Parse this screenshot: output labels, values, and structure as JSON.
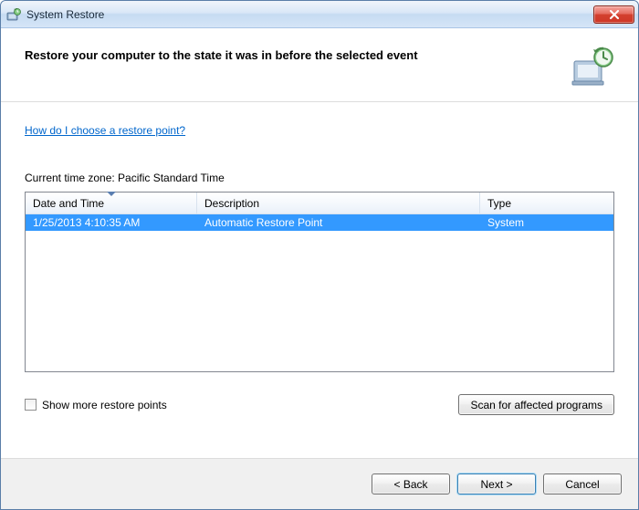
{
  "window": {
    "title": "System Restore"
  },
  "header": {
    "title": "Restore your computer to the state it was in before the selected event"
  },
  "help_link": "How do I choose a restore point?",
  "timezone_label": "Current time zone: Pacific Standard Time",
  "table": {
    "columns": {
      "date_time": "Date and Time",
      "description": "Description",
      "type": "Type"
    },
    "rows": [
      {
        "date_time": "1/25/2013 4:10:35 AM",
        "description": "Automatic Restore Point",
        "type": "System",
        "selected": true
      }
    ]
  },
  "checkbox": {
    "show_more": "Show more restore points"
  },
  "buttons": {
    "scan": "Scan for affected programs",
    "back": "< Back",
    "next": "Next >",
    "cancel": "Cancel"
  }
}
